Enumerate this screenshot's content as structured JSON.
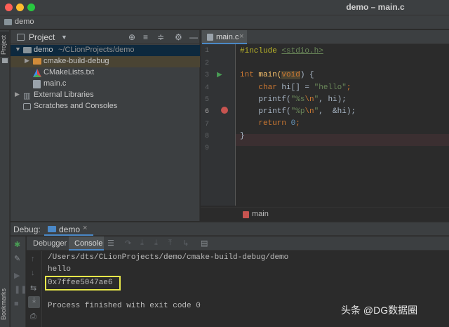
{
  "window": {
    "title": "demo – main.c"
  },
  "navbar": {
    "project": "demo"
  },
  "stripe": {
    "project_label": "Project",
    "bookmarks_label": "Bookmarks"
  },
  "project_panel": {
    "title": "Project",
    "tree": [
      {
        "name": "demo",
        "path": "~/CLionProjects/demo"
      },
      {
        "name": "cmake-build-debug"
      },
      {
        "name": "CMakeLists.txt"
      },
      {
        "name": "main.c"
      },
      {
        "name": "External Libraries"
      },
      {
        "name": "Scratches and Consoles"
      }
    ]
  },
  "editor": {
    "tab_label": "main.c",
    "line_numbers": [
      "1",
      "2",
      "3",
      "4",
      "5",
      "6",
      "7",
      "8",
      "9"
    ],
    "code": {
      "l1_kw": "#include",
      "l1_hdr": "<stdio.h>",
      "l3_type": "int",
      "l3_fn": " main(",
      "l3_void": "void",
      "l3_end": ") {",
      "l4_type": "char",
      "l4_mid": " hi[] = ",
      "l4_str": "\"hello\"",
      "l4_end": ";",
      "l5_fn": "printf(",
      "l5_str1": "\"%s",
      "l5_esc": "\\n",
      "l5_str2": "\"",
      "l5_end": ", hi);",
      "l6_fn": "printf(",
      "l6_str1": "\"%p",
      "l6_esc": "\\n",
      "l6_str2": "\"",
      "l6_end": ",  &hi);",
      "l7_kw": "return",
      "l7_num": "0",
      "l7_end": ";",
      "l8": "}"
    },
    "breadcrumb": "main"
  },
  "debug": {
    "label": "Debug:",
    "config": "demo",
    "tabs": [
      "Debugger",
      "Console"
    ]
  },
  "console": {
    "lines": [
      "/Users/dts/CLionProjects/demo/cmake-build-debug/demo",
      "hello",
      "0x7ffee5047ae6",
      "Process finished with exit code 0"
    ]
  },
  "watermark": "头条 @DG数据圈",
  "colors": {
    "keyword": "#cc7832",
    "string": "#6a8759",
    "number": "#6897bb",
    "macro": "#bbb529",
    "highlight_box": "#e8e84a",
    "breakpoint": "#c75450",
    "run": "#499c54"
  }
}
